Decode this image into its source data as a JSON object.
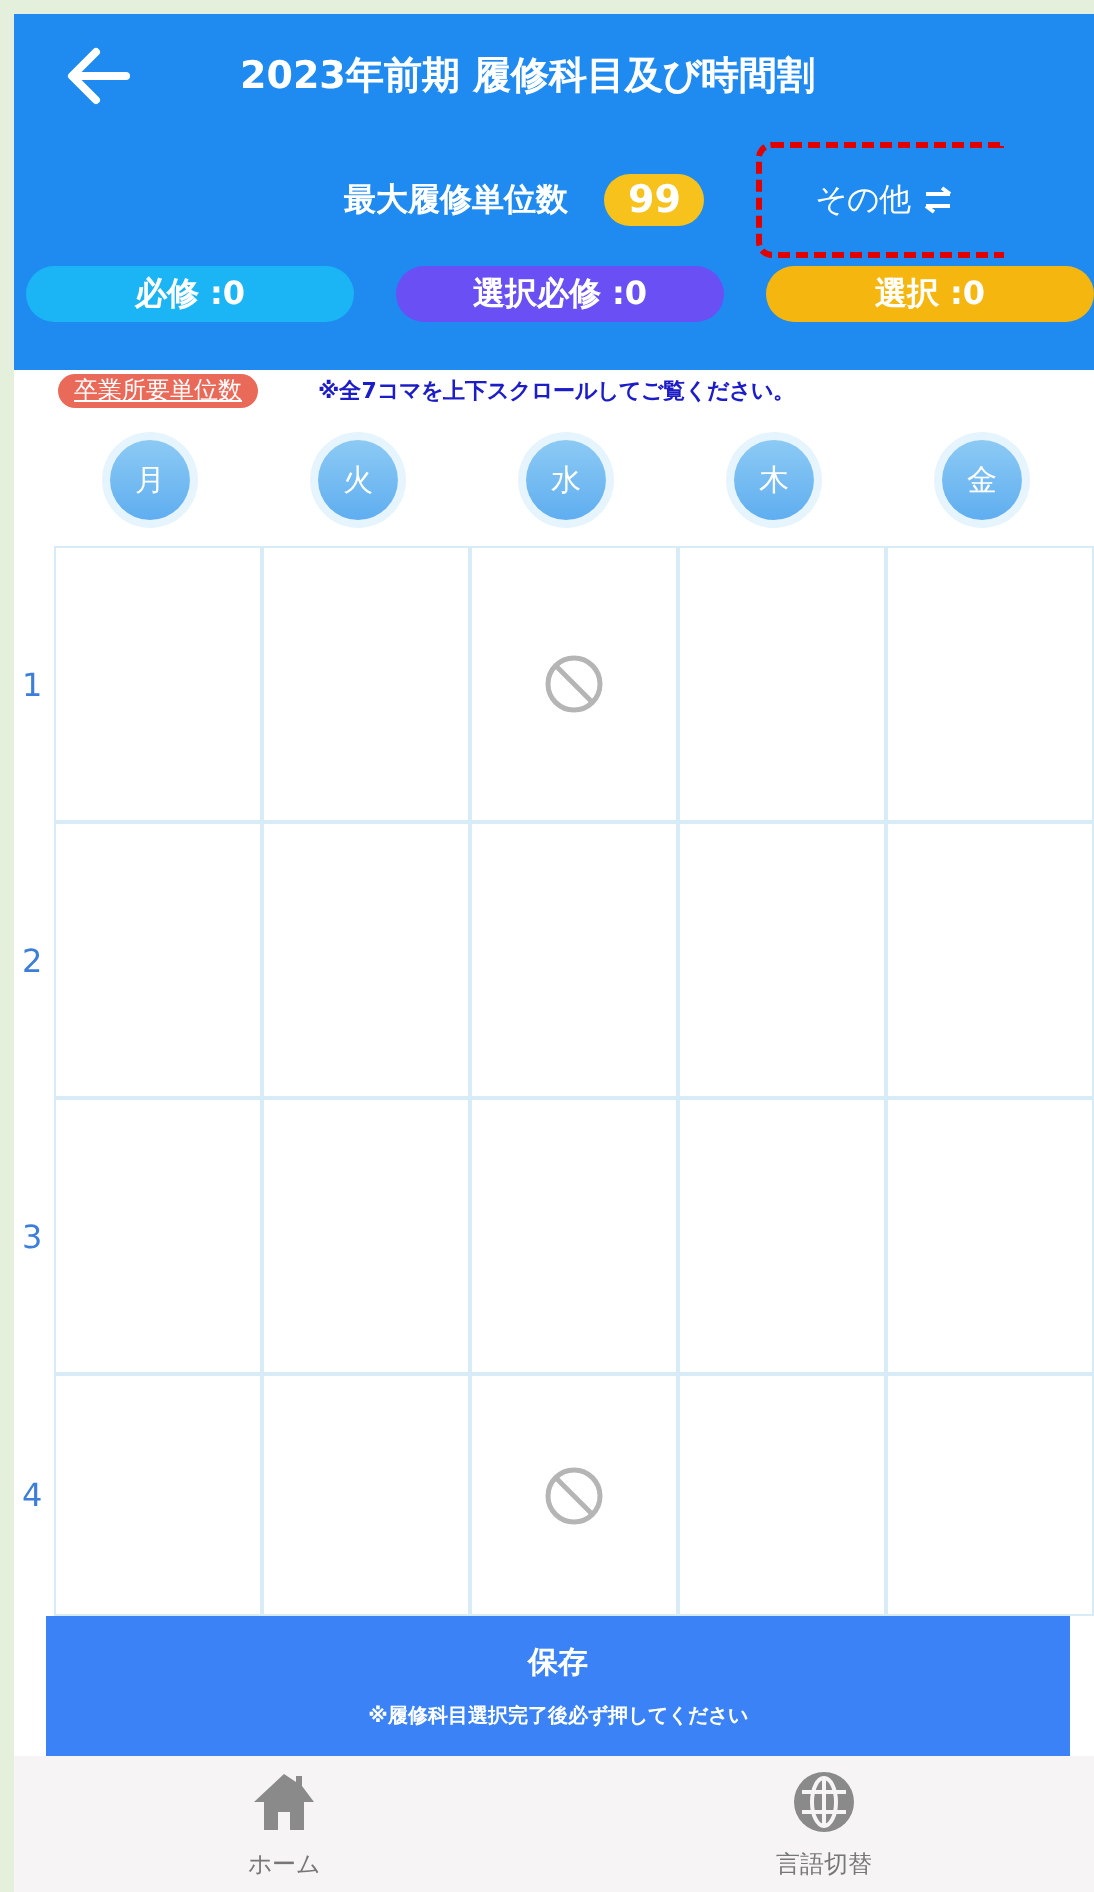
{
  "header": {
    "title": "2023年前期 履修科目及び時間割",
    "max_units_label": "最大履修単位数",
    "max_units_value": "99",
    "other_button": {
      "label": "その他",
      "highlighted": true
    }
  },
  "categories": [
    {
      "label": "必修 :0",
      "color": "#1bb4f5"
    },
    {
      "label": "選択必修 :0",
      "color": "#6a4ff5"
    },
    {
      "label": "選択 :0",
      "color": "#f5b70f"
    }
  ],
  "graduation_badge": "卒業所要単位数",
  "scroll_note": "※全7コマを上下スクロールしてご覧ください。",
  "days": [
    "月",
    "火",
    "水",
    "木",
    "金"
  ],
  "periods": [
    {
      "label": "1",
      "cells": [
        {
          "kind": "empty"
        },
        {
          "kind": "empty"
        },
        {
          "kind": "unavailable"
        },
        {
          "kind": "empty"
        },
        {
          "kind": "empty"
        }
      ]
    },
    {
      "label": "2",
      "cells": [
        {
          "kind": "empty"
        },
        {
          "kind": "empty"
        },
        {
          "kind": "empty"
        },
        {
          "kind": "empty"
        },
        {
          "kind": "empty"
        }
      ]
    },
    {
      "label": "3",
      "cells": [
        {
          "kind": "empty"
        },
        {
          "kind": "empty"
        },
        {
          "kind": "empty"
        },
        {
          "kind": "empty"
        },
        {
          "kind": "empty"
        }
      ]
    },
    {
      "label": "4",
      "cells": [
        {
          "kind": "empty"
        },
        {
          "kind": "empty"
        },
        {
          "kind": "unavailable"
        },
        {
          "kind": "empty"
        },
        {
          "kind": "empty"
        }
      ]
    }
  ],
  "save_button": {
    "label": "保存",
    "note": "※履修科目選択完了後必ず押してください"
  },
  "bottom_nav": [
    {
      "label": "ホーム"
    },
    {
      "label": "言語切替"
    }
  ]
}
